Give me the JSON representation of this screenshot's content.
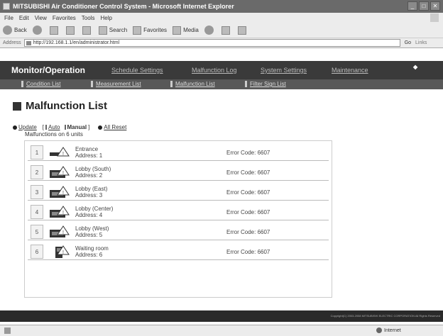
{
  "window": {
    "title": "MITSUBISHI Air Conditioner Control System - Microsoft Internet Explorer",
    "menu": [
      "File",
      "Edit",
      "View",
      "Favorites",
      "Tools",
      "Help"
    ],
    "toolbar": {
      "back": "Back",
      "search": "Search",
      "favorites": "Favorites",
      "media": "Media"
    },
    "address_label": "Address",
    "address": "http://192.168.1.1/en/administrator.html",
    "go": "Go",
    "links": "Links"
  },
  "nav": {
    "brand": "Monitor/Operation",
    "items": [
      "Schedule Settings",
      "Malfunction Log",
      "System Settings",
      "Maintenance"
    ],
    "logo": "MITSUBISHI ELECTRIC"
  },
  "subnav": [
    "Condition List",
    "Measurement List",
    "Malfunction List",
    "Filter Sign List"
  ],
  "page": {
    "title": "Malfunction List",
    "update": "Update",
    "auto": "Auto",
    "manual": "Manual",
    "all_reset": "All Reset",
    "count_text": "Malfunctions on 6 units"
  },
  "rows": [
    {
      "num": "1",
      "name": "Entrance",
      "address": "Address: 1",
      "error": "Error Code: 6607",
      "icon": "ceiling-unit-warning-icon"
    },
    {
      "num": "2",
      "name": "Lobby (South)",
      "address": "Address: 2",
      "error": "Error Code: 6607",
      "icon": "cassette-unit-warning-icon"
    },
    {
      "num": "3",
      "name": "Lobby (East)",
      "address": "Address: 3",
      "error": "Error Code: 6607",
      "icon": "cassette-unit-warning-icon"
    },
    {
      "num": "4",
      "name": "Lobby (Center)",
      "address": "Address: 4",
      "error": "Error Code: 6607",
      "icon": "cassette-unit-warning-icon"
    },
    {
      "num": "5",
      "name": "Lobby (West)",
      "address": "Address: 5",
      "error": "Error Code: 6607",
      "icon": "cassette-unit-warning-icon"
    },
    {
      "num": "6",
      "name": "Waiting room",
      "address": "Address: 6",
      "error": "Error Code: 6607",
      "icon": "floor-unit-warning-icon"
    }
  ],
  "footer": {
    "copyright": "Copyright(C) 2003-2008 MITSUBISHI ELECTRIC CORPORATION All Rights Reserved"
  },
  "status": {
    "zone": "Internet"
  }
}
